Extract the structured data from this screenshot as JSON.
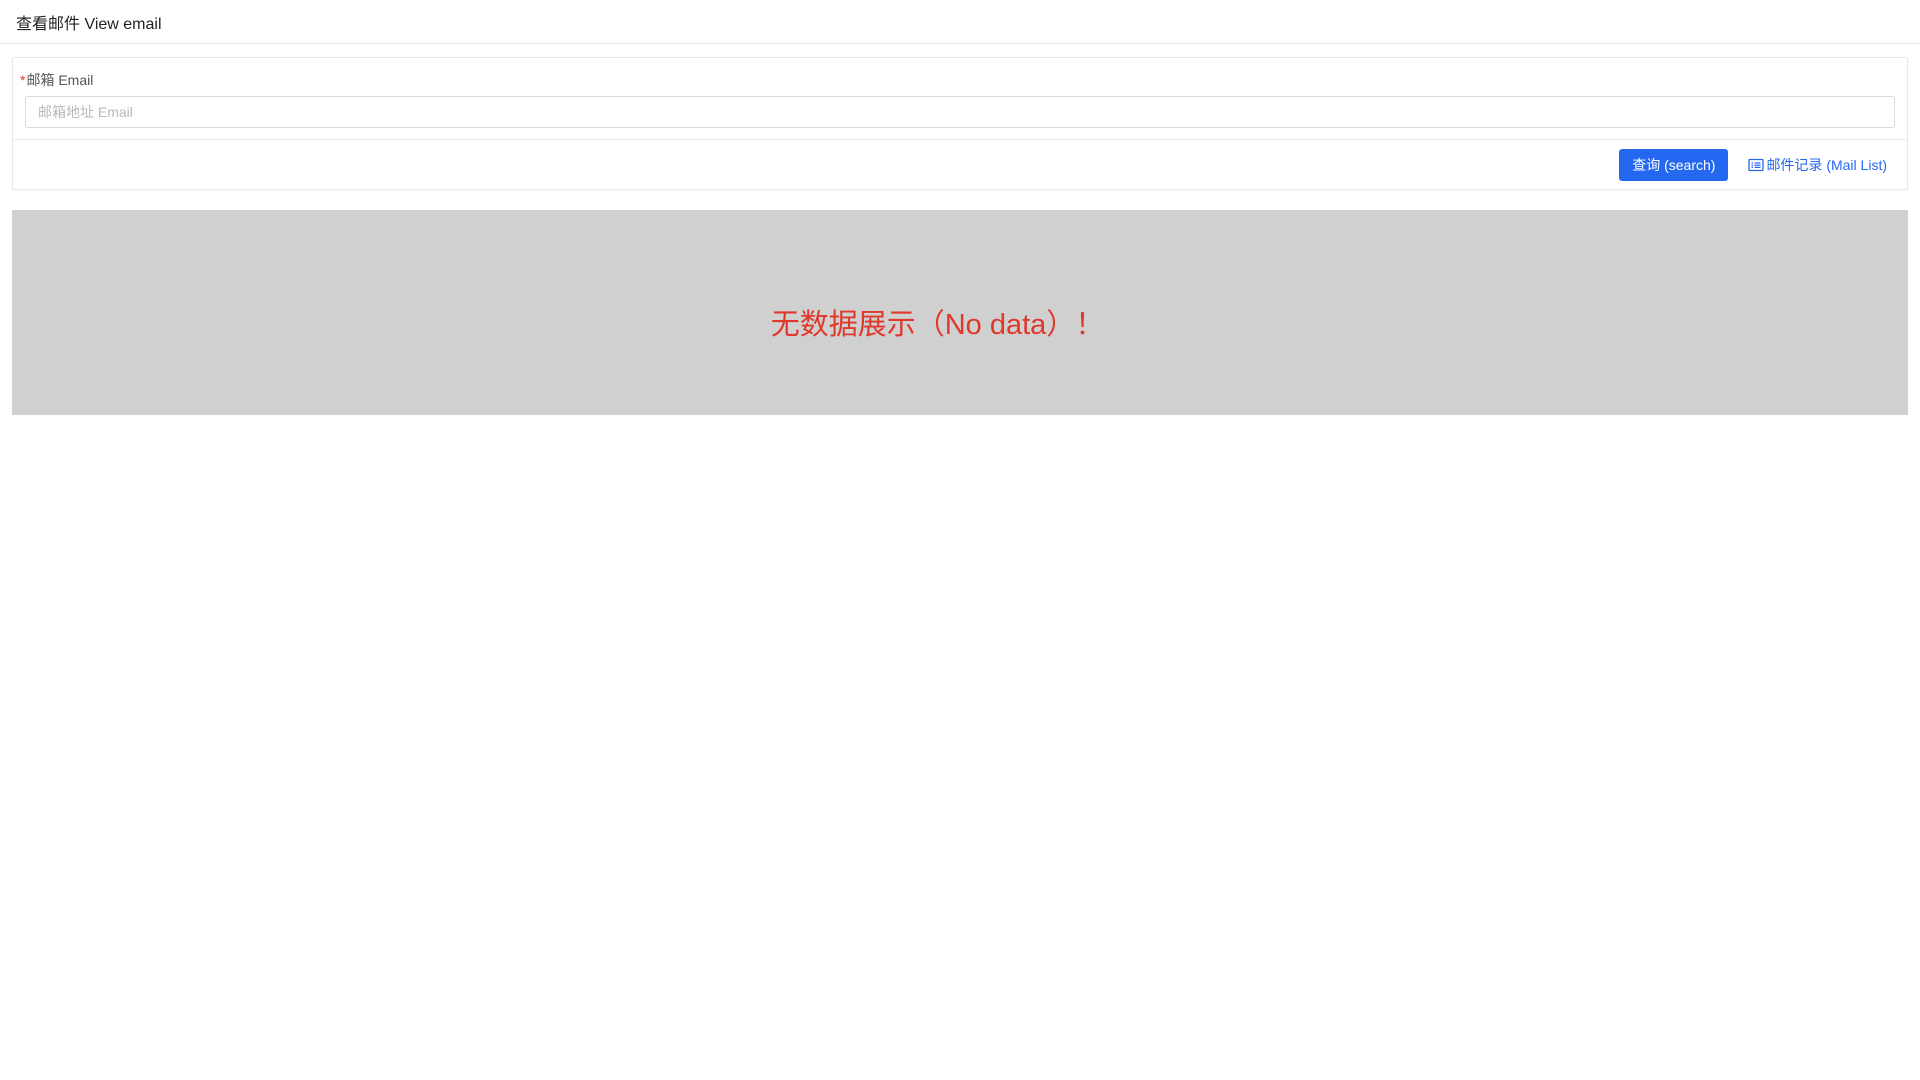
{
  "header": {
    "title": "查看邮件 View email"
  },
  "form": {
    "required_mark": "*",
    "email_label": "邮箱 Email",
    "email_value": "",
    "email_placeholder": "邮箱地址 Email"
  },
  "actions": {
    "search_label": "查询 (search)",
    "mail_list_label": "邮件记录 (Mail List)",
    "mail_list_icon": "list-icon"
  },
  "result": {
    "empty_message": "无数据展示（No data）！"
  },
  "colors": {
    "primary": "#2468f2",
    "error_text": "#e0382b",
    "empty_background": "#d0d0d0"
  }
}
